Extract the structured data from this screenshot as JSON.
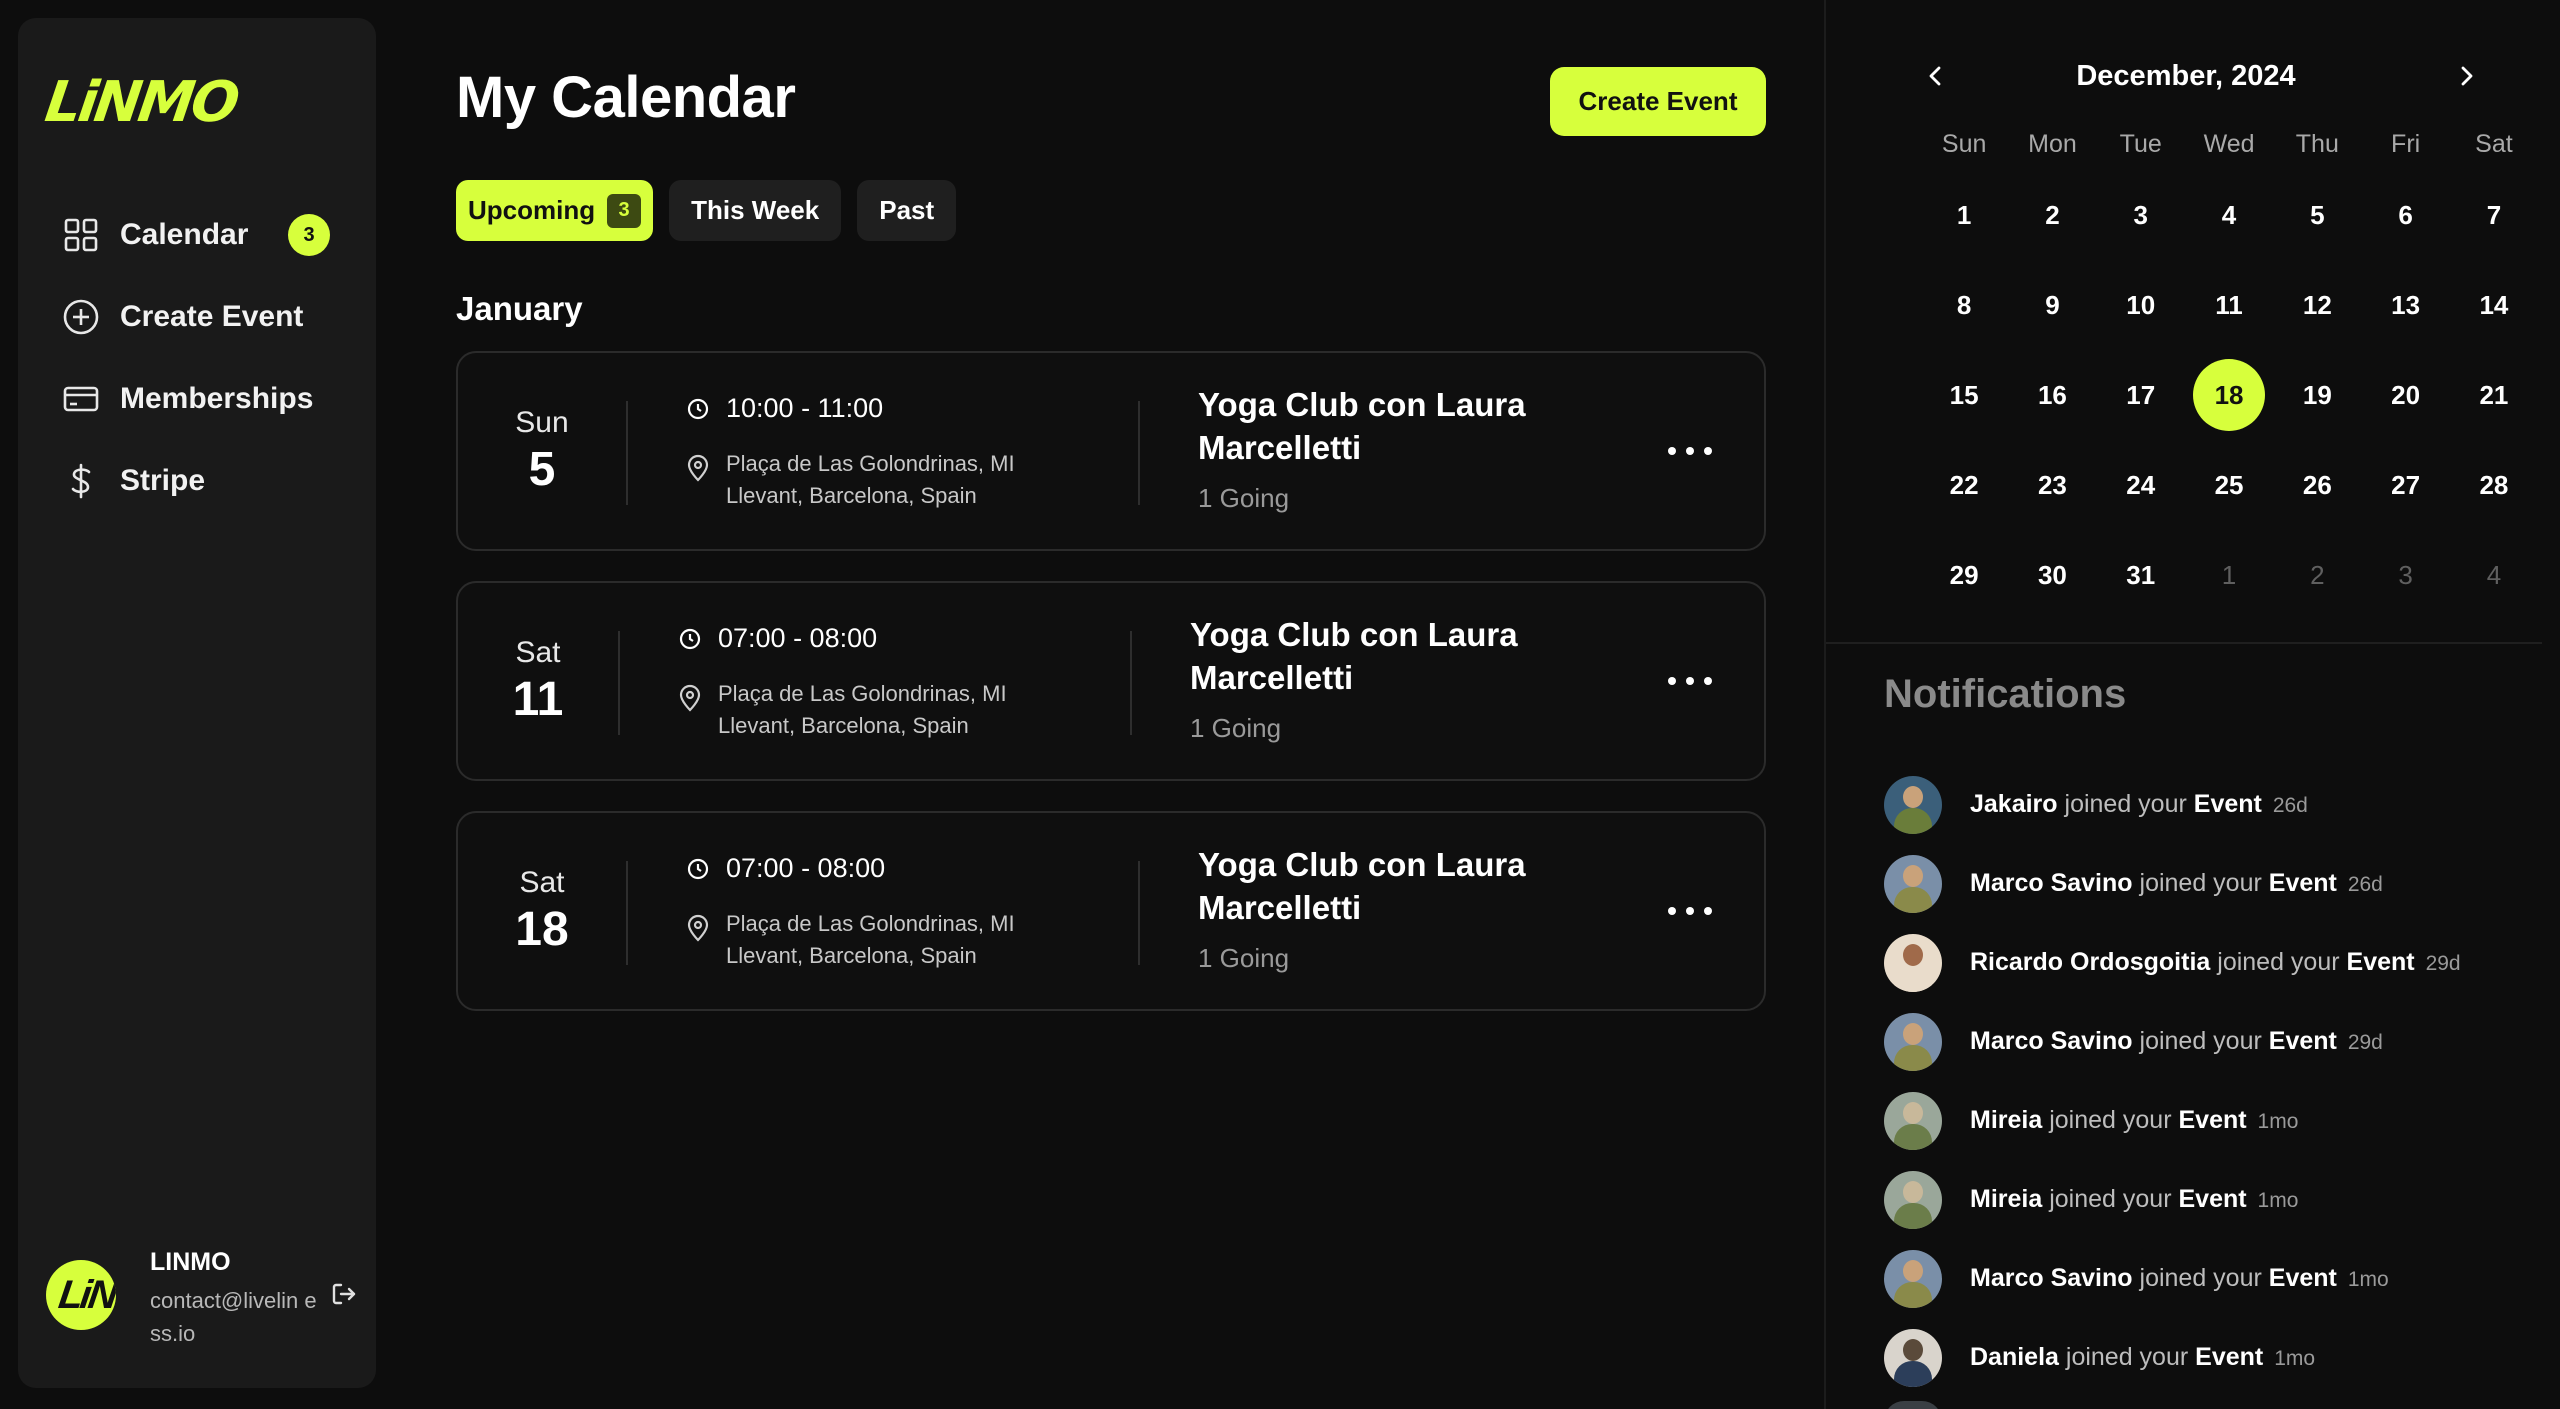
{
  "brand": {
    "logo_text": "LiNMO",
    "accent_color": "#d7ff3c"
  },
  "sidebar": {
    "items": [
      {
        "label": "Calendar",
        "icon": "grid-icon",
        "badge": "3"
      },
      {
        "label": "Create Event",
        "icon": "plus-circle-icon"
      },
      {
        "label": "Memberships",
        "icon": "card-icon"
      },
      {
        "label": "Stripe",
        "icon": "dollar-icon"
      }
    ],
    "user": {
      "avatar_text": "LiN",
      "name": "LINMO",
      "email": "contact@livelin ess.io"
    }
  },
  "main": {
    "title": "My Calendar",
    "create_button": "Create Event",
    "tabs": [
      {
        "label": "Upcoming",
        "count": "3",
        "active": true
      },
      {
        "label": "This Week",
        "active": false
      },
      {
        "label": "Past",
        "active": false
      }
    ],
    "month_heading": "January",
    "events": [
      {
        "dow": "Sun",
        "day": "5",
        "time": "10:00 - 11:00",
        "location": "Plaça de Las Golondrinas, MI Llevant, Barcelona, Spain",
        "title": "Yoga Club con Laura Marcelletti",
        "going": "1 Going"
      },
      {
        "dow": "Sat",
        "day": "11",
        "time": "07:00 - 08:00",
        "location": "Plaça de Las Golondrinas, MI Llevant, Barcelona, Spain",
        "title": "Yoga Club con Laura Marcelletti",
        "going": "1 Going"
      },
      {
        "dow": "Sat",
        "day": "18",
        "time": "07:00 - 08:00",
        "location": "Plaça de Las Golondrinas, MI Llevant, Barcelona, Spain",
        "title": "Yoga Club con Laura Marcelletti",
        "going": "1 Going"
      }
    ]
  },
  "calendar": {
    "title": "December, 2024",
    "weekdays": [
      "Sun",
      "Mon",
      "Tue",
      "Wed",
      "Thu",
      "Fri",
      "Sat"
    ],
    "weeks": [
      [
        "1",
        "2",
        "3",
        "4",
        "5",
        "6",
        "7"
      ],
      [
        "8",
        "9",
        "10",
        "11",
        "12",
        "13",
        "14"
      ],
      [
        "15",
        "16",
        "17",
        "18",
        "19",
        "20",
        "21"
      ],
      [
        "22",
        "23",
        "24",
        "25",
        "26",
        "27",
        "28"
      ],
      [
        "29",
        "30",
        "31",
        "1",
        "2",
        "3",
        "4"
      ]
    ],
    "selected_day": "18",
    "next_month_days_in_last_row": 4
  },
  "notifications": {
    "title": "Notifications",
    "verb": "joined your",
    "object": "Event",
    "items": [
      {
        "name": "Jakairo",
        "time": "26d",
        "avatar_colors": [
          "#3b5f7a",
          "#c9a27a",
          "#6a7d3a"
        ]
      },
      {
        "name": "Marco Savino",
        "time": "26d",
        "avatar_colors": [
          "#7a8fa8",
          "#c9a27a",
          "#8a8a4a"
        ]
      },
      {
        "name": "Ricardo Ordosgoitia",
        "time": "29d",
        "avatar_colors": [
          "#e9dccb",
          "#a06a4a",
          "#e9dccb"
        ]
      },
      {
        "name": "Marco Savino",
        "time": "29d",
        "avatar_colors": [
          "#7a8fa8",
          "#c9a27a",
          "#8a8a4a"
        ]
      },
      {
        "name": "Mireia",
        "time": "1mo",
        "avatar_colors": [
          "#9aa79a",
          "#c8b89a",
          "#6b7d4a"
        ]
      },
      {
        "name": "Mireia",
        "time": "1mo",
        "avatar_colors": [
          "#9aa79a",
          "#c8b89a",
          "#6b7d4a"
        ]
      },
      {
        "name": "Marco Savino",
        "time": "1mo",
        "avatar_colors": [
          "#7a8fa8",
          "#c9a27a",
          "#8a8a4a"
        ]
      },
      {
        "name": "Daniela",
        "time": "1mo",
        "avatar_colors": [
          "#d9d4cc",
          "#5a4a3a",
          "#2c3e5a"
        ]
      }
    ]
  }
}
